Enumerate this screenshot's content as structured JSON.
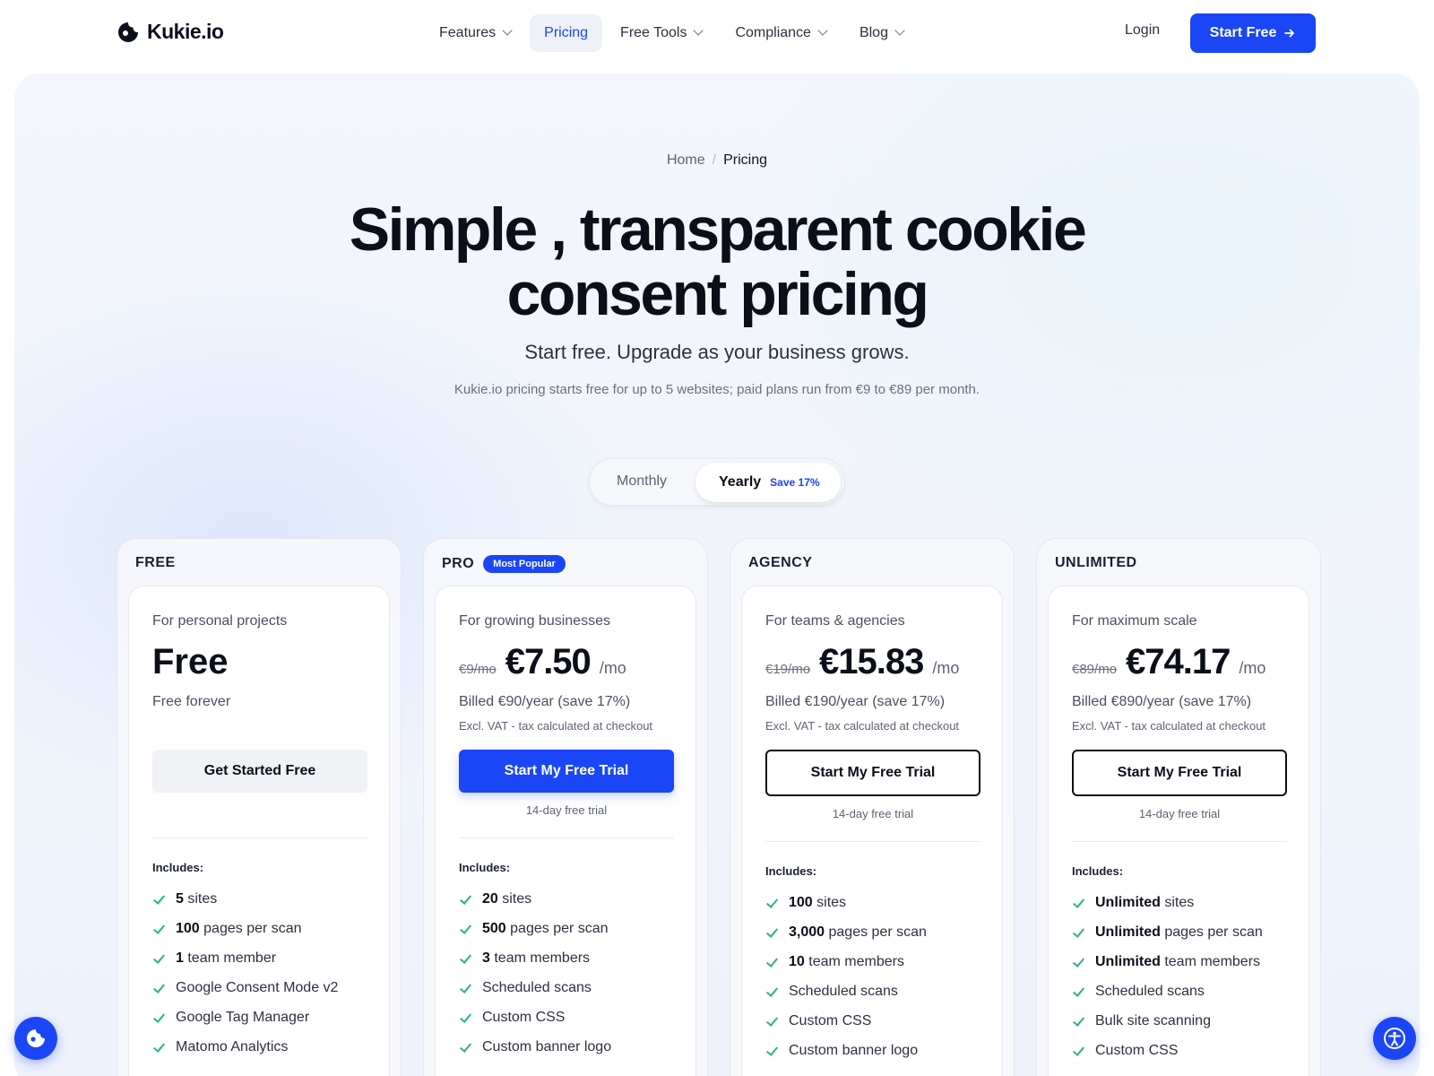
{
  "nav": {
    "logo": "Kukie.io",
    "items": [
      {
        "label": "Features",
        "dropdown": true,
        "active": false
      },
      {
        "label": "Pricing",
        "dropdown": false,
        "active": true
      },
      {
        "label": "Free Tools",
        "dropdown": true,
        "active": false
      },
      {
        "label": "Compliance",
        "dropdown": true,
        "active": false
      },
      {
        "label": "Blog",
        "dropdown": true,
        "active": false
      }
    ],
    "login": "Login",
    "cta": "Start Free",
    "cta_icon": "arrow-right-icon"
  },
  "breadcrumb": {
    "home": "Home",
    "separator": "/",
    "current": "Pricing"
  },
  "hero": {
    "title_line1": "Simple , transparent cookie",
    "title_line2": "consent pricing",
    "subtitle": "Start free. Upgrade as your business grows.",
    "description": "Kukie.io pricing starts free for up to 5 websites; paid plans run from €9 to €89 per month."
  },
  "billing_toggle": {
    "monthly": "Monthly",
    "yearly": "Yearly",
    "yearly_badge": "Save 17%",
    "selected": "Yearly"
  },
  "plans": [
    {
      "label": "FREE",
      "tagline": "For personal projects",
      "price": "Free",
      "billed": "Free forever",
      "cta": "Get Started Free",
      "includes": "Includes:",
      "features": [
        {
          "b": "5",
          "t": " sites"
        },
        {
          "b": "100",
          "t": " pages per scan"
        },
        {
          "b": "1",
          "t": " team member"
        },
        {
          "b": "",
          "t": "Google Consent Mode v2"
        },
        {
          "b": "",
          "t": "Google Tag Manager"
        },
        {
          "b": "",
          "t": "Matomo Analytics"
        }
      ]
    },
    {
      "label": "PRO",
      "badge": "Most Popular",
      "tagline": "For growing businesses",
      "old_price": "€9/mo",
      "price": "€7.50",
      "per": "/mo",
      "billed": "Billed €90/year (save 17%)",
      "vat": "Excl. VAT - tax calculated at checkout",
      "cta": "Start My Free Trial",
      "trial": "14-day free trial",
      "includes": "Includes:",
      "features": [
        {
          "b": "20",
          "t": " sites"
        },
        {
          "b": "500",
          "t": " pages per scan"
        },
        {
          "b": "3",
          "t": " team members"
        },
        {
          "b": "",
          "t": "Scheduled scans"
        },
        {
          "b": "",
          "t": "Custom CSS"
        },
        {
          "b": "",
          "t": "Custom banner logo"
        }
      ]
    },
    {
      "label": "AGENCY",
      "tagline": "For teams & agencies",
      "old_price": "€19/mo",
      "price": "€15.83",
      "per": "/mo",
      "billed": "Billed €190/year (save 17%)",
      "vat": "Excl. VAT - tax calculated at checkout",
      "cta": "Start My Free Trial",
      "trial": "14-day free trial",
      "includes": "Includes:",
      "features": [
        {
          "b": "100",
          "t": " sites"
        },
        {
          "b": "3,000",
          "t": " pages per scan"
        },
        {
          "b": "10",
          "t": " team members"
        },
        {
          "b": "",
          "t": "Scheduled scans"
        },
        {
          "b": "",
          "t": "Custom CSS"
        },
        {
          "b": "",
          "t": "Custom banner logo"
        }
      ]
    },
    {
      "label": "UNLIMITED",
      "tagline": "For maximum scale",
      "old_price": "€89/mo",
      "price": "€74.17",
      "per": "/mo",
      "billed": "Billed €890/year (save 17%)",
      "vat": "Excl. VAT - tax calculated at checkout",
      "cta": "Start My Free Trial",
      "trial": "14-day free trial",
      "includes": "Includes:",
      "features": [
        {
          "b": "Unlimited",
          "t": " sites"
        },
        {
          "b": "Unlimited",
          "t": " pages per scan"
        },
        {
          "b": "Unlimited",
          "t": " team members"
        },
        {
          "b": "",
          "t": "Scheduled scans"
        },
        {
          "b": "",
          "t": "Bulk site scanning"
        },
        {
          "b": "",
          "t": "Custom CSS"
        }
      ]
    }
  ],
  "floating": {
    "left_icon": "cookie-icon",
    "right_icon": "accessibility-icon"
  },
  "colors": {
    "accent": "#1a46f5",
    "check": "#2bb673",
    "text": "#0b0f19"
  }
}
